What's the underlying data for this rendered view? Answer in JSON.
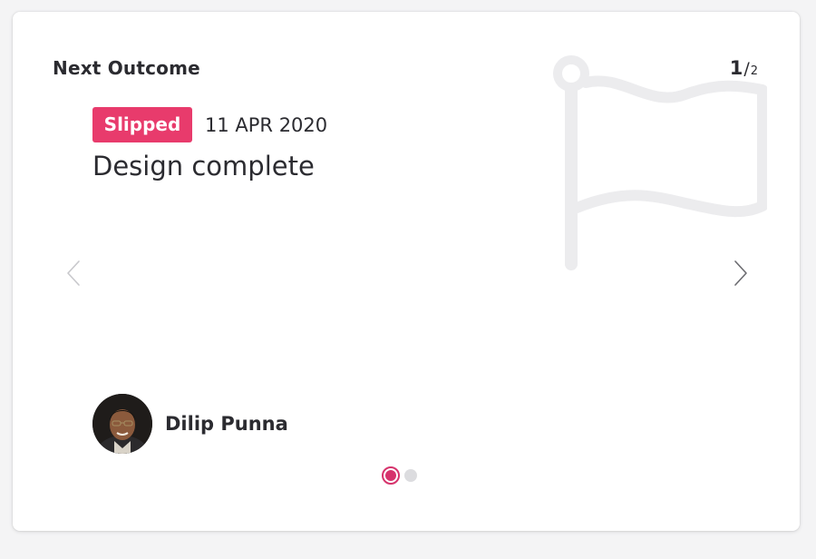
{
  "card": {
    "title": "Next Outcome",
    "pager": {
      "current": "1",
      "separator": "/",
      "total": "2"
    }
  },
  "outcome": {
    "status": "Slipped",
    "date": "11 APR 2020",
    "name": "Design complete",
    "owner": "Dilip Punna"
  },
  "colors": {
    "status_badge": "#e83b6c",
    "active_dot": "#d6336c",
    "inactive_dot": "#dcdcdf",
    "text": "#2b2b30",
    "flag_watermark": "#ececee"
  },
  "icons": {
    "watermark": "flag-icon",
    "previous": "chevron-left-icon",
    "next": "chevron-right-icon"
  },
  "pagination": {
    "pages": 2,
    "active": 1
  }
}
